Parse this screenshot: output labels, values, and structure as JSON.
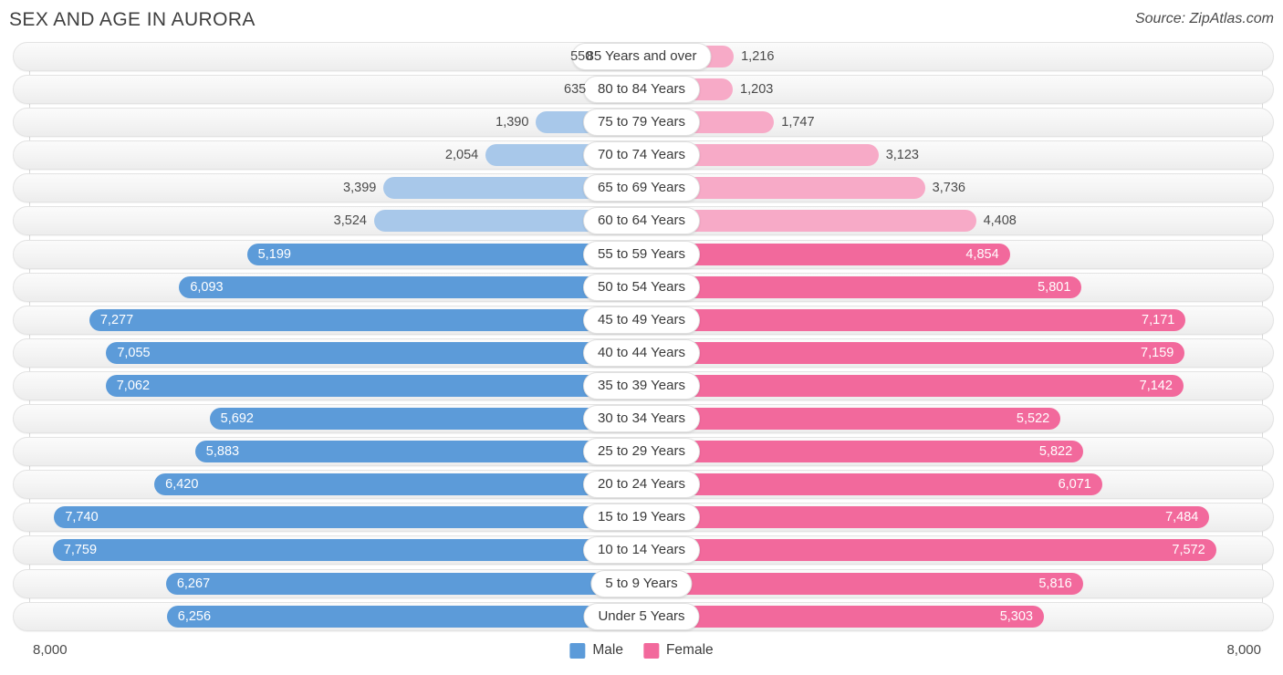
{
  "header": {
    "title": "SEX AND AGE IN AURORA",
    "source": "Source: ZipAtlas.com"
  },
  "legend": {
    "male_label": "Male",
    "female_label": "Female",
    "male_color": "#5c9bd9",
    "female_color": "#f2699c",
    "male_color_light": "#a8c8ea",
    "female_color_light": "#f7aac7"
  },
  "axis": {
    "left_max_label": "8,000",
    "right_max_label": "8,000",
    "max_value": 8000
  },
  "chart_data": {
    "type": "bar",
    "title": "SEX AND AGE IN AURORA",
    "subtitle": "",
    "xlabel": "",
    "ylabel": "",
    "orientation": "horizontal",
    "style": "population-pyramid",
    "legend_position": "bottom-center",
    "grid": false,
    "xlim": [
      0,
      8000
    ],
    "categories": [
      "85 Years and over",
      "80 to 84 Years",
      "75 to 79 Years",
      "70 to 74 Years",
      "65 to 69 Years",
      "60 to 64 Years",
      "55 to 59 Years",
      "50 to 54 Years",
      "45 to 49 Years",
      "40 to 44 Years",
      "35 to 39 Years",
      "30 to 34 Years",
      "25 to 29 Years",
      "20 to 24 Years",
      "15 to 19 Years",
      "10 to 14 Years",
      "5 to 9 Years",
      "Under 5 Years"
    ],
    "series": [
      {
        "name": "Male",
        "values": [
          550,
          635,
          1390,
          2054,
          3399,
          3524,
          5199,
          6093,
          7277,
          7055,
          7062,
          5692,
          5883,
          6420,
          7740,
          7759,
          6267,
          6256
        ],
        "labels": [
          "550",
          "635",
          "1,390",
          "2,054",
          "3,399",
          "3,524",
          "5,199",
          "6,093",
          "7,277",
          "7,055",
          "7,062",
          "5,692",
          "5,883",
          "6,420",
          "7,740",
          "7,759",
          "6,267",
          "6,256"
        ]
      },
      {
        "name": "Female",
        "values": [
          1216,
          1203,
          1747,
          3123,
          3736,
          4408,
          4854,
          5801,
          7171,
          7159,
          7142,
          5522,
          5822,
          6071,
          7484,
          7572,
          5816,
          5303
        ],
        "labels": [
          "1,216",
          "1,203",
          "1,747",
          "3,123",
          "3,736",
          "4,408",
          "4,854",
          "5,801",
          "7,171",
          "7,159",
          "7,142",
          "5,522",
          "5,822",
          "6,071",
          "7,484",
          "7,572",
          "5,816",
          "5,303"
        ]
      }
    ]
  },
  "rows": [
    {
      "category": "85 Years and over",
      "male": 550,
      "male_label": "550",
      "female": 1216,
      "female_label": "1,216"
    },
    {
      "category": "80 to 84 Years",
      "male": 635,
      "male_label": "635",
      "female": 1203,
      "female_label": "1,203"
    },
    {
      "category": "75 to 79 Years",
      "male": 1390,
      "male_label": "1,390",
      "female": 1747,
      "female_label": "1,747"
    },
    {
      "category": "70 to 74 Years",
      "male": 2054,
      "male_label": "2,054",
      "female": 3123,
      "female_label": "3,123"
    },
    {
      "category": "65 to 69 Years",
      "male": 3399,
      "male_label": "3,399",
      "female": 3736,
      "female_label": "3,736"
    },
    {
      "category": "60 to 64 Years",
      "male": 3524,
      "male_label": "3,524",
      "female": 4408,
      "female_label": "4,408"
    },
    {
      "category": "55 to 59 Years",
      "male": 5199,
      "male_label": "5,199",
      "female": 4854,
      "female_label": "4,854"
    },
    {
      "category": "50 to 54 Years",
      "male": 6093,
      "male_label": "6,093",
      "female": 5801,
      "female_label": "5,801"
    },
    {
      "category": "45 to 49 Years",
      "male": 7277,
      "male_label": "7,277",
      "female": 7171,
      "female_label": "7,171"
    },
    {
      "category": "40 to 44 Years",
      "male": 7055,
      "male_label": "7,055",
      "female": 7159,
      "female_label": "7,159"
    },
    {
      "category": "35 to 39 Years",
      "male": 7062,
      "male_label": "7,062",
      "female": 7142,
      "female_label": "7,142"
    },
    {
      "category": "30 to 34 Years",
      "male": 5692,
      "male_label": "5,692",
      "female": 5522,
      "female_label": "5,522"
    },
    {
      "category": "25 to 29 Years",
      "male": 5883,
      "male_label": "5,883",
      "female": 5822,
      "female_label": "5,822"
    },
    {
      "category": "20 to 24 Years",
      "male": 6420,
      "male_label": "6,420",
      "female": 6071,
      "female_label": "6,071"
    },
    {
      "category": "15 to 19 Years",
      "male": 7740,
      "male_label": "7,740",
      "female": 7484,
      "female_label": "7,484"
    },
    {
      "category": "10 to 14 Years",
      "male": 7759,
      "male_label": "7,759",
      "female": 7572,
      "female_label": "7,572"
    },
    {
      "category": "5 to 9 Years",
      "male": 6267,
      "male_label": "6,267",
      "female": 5816,
      "female_label": "5,816"
    },
    {
      "category": "Under 5 Years",
      "male": 6256,
      "male_label": "6,256",
      "female": 5303,
      "female_label": "5,303"
    }
  ]
}
